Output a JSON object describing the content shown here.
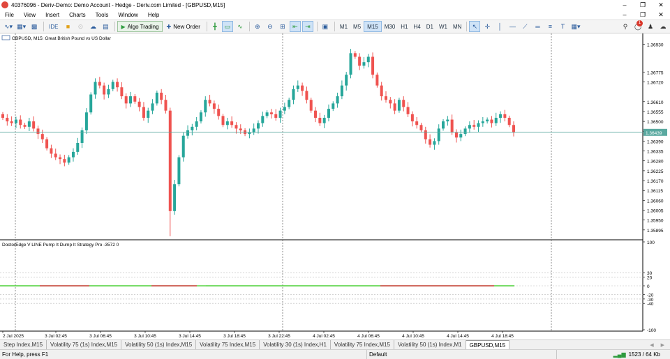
{
  "window": {
    "title": "40376096 - Deriv-Demo: Demo Account - Hedge - Deriv.com Limited - [GBPUSD,M15]",
    "minimize_icon": "minimize-icon",
    "maximize_icon": "restore-icon",
    "close_icon": "close-icon"
  },
  "menu": [
    "File",
    "View",
    "Insert",
    "Charts",
    "Tools",
    "Window",
    "Help"
  ],
  "toolbar": {
    "ide_label": "IDE",
    "algo_label": "Algo Trading",
    "neworder_label": "New Order",
    "timeframes": [
      "M1",
      "M5",
      "M15",
      "M30",
      "H1",
      "H4",
      "D1",
      "W1",
      "MN"
    ],
    "active_timeframe": "M15",
    "notification_count": "1"
  },
  "chart": {
    "symbol_caption": "GBPUSD, M15:  Great British Pound vs US Dollar",
    "indicator_caption": "DoctorEdge V LINE Pump It Dump It Strategy Pro -3572 0",
    "current_price": "1.36439",
    "price_ticks": [
      "1.36930",
      "1.36775",
      "1.36720",
      "1.36610",
      "1.36555",
      "1.36500",
      "1.36445",
      "1.36390",
      "1.36335",
      "1.36280",
      "1.36225",
      "1.36170",
      "1.36115",
      "1.36060",
      "1.36005",
      "1.35950",
      "1.35895"
    ],
    "indicator_ticks": [
      "100",
      "30",
      "20",
      "0",
      "-20",
      "-30",
      "-40",
      "-100"
    ],
    "time_ticks": [
      "2 Jul 2025",
      "3 Jul 02:45",
      "3 Jul 06:45",
      "3 Jul 10:45",
      "3 Jul 14:45",
      "3 Jul 18:45",
      "3 Jul 22:45",
      "4 Jul 02:45",
      "4 Jul 06:45",
      "4 Jul 10:45",
      "4 Jul 14:45",
      "4 Jul 18:45"
    ],
    "colors": {
      "bull": "#26a69a",
      "bear": "#ef5350",
      "price_line": "#5aa9a0",
      "ind_green": "#4cd137",
      "ind_red": "#c0392b"
    }
  },
  "chart_data": {
    "type": "candlestick",
    "symbol": "GBPUSD",
    "timeframe": "M15",
    "ylim": [
      1.3584,
      1.3699
    ],
    "close_series_approx": [
      1.3652,
      1.365,
      1.3649,
      1.3651,
      1.3648,
      1.3647,
      1.365,
      1.3646,
      1.3643,
      1.364,
      1.3635,
      1.3632,
      1.363,
      1.3629,
      1.3627,
      1.363,
      1.3633,
      1.3638,
      1.3645,
      1.3655,
      1.3665,
      1.3672,
      1.367,
      1.3665,
      1.3668,
      1.3672,
      1.3669,
      1.3664,
      1.366,
      1.3664,
      1.3661,
      1.3658,
      1.3652,
      1.3656,
      1.366,
      1.3666,
      1.3662,
      1.3656,
      1.36,
      1.3615,
      1.363,
      1.3642,
      1.3645,
      1.3647,
      1.365,
      1.3655,
      1.3662,
      1.366,
      1.3657,
      1.3653,
      1.3648,
      1.365,
      1.3648,
      1.3646,
      1.3645,
      1.3643,
      1.3644,
      1.3646,
      1.3649,
      1.3653,
      1.3655,
      1.3654,
      1.3652,
      1.3656,
      1.3658,
      1.3662,
      1.3668,
      1.367,
      1.3667,
      1.3662,
      1.3656,
      1.3652,
      1.3649,
      1.3652,
      1.3657,
      1.366,
      1.3664,
      1.367,
      1.3676,
      1.3688,
      1.3686,
      1.3681,
      1.3683,
      1.3686,
      1.3676,
      1.367,
      1.3664,
      1.3662,
      1.366,
      1.3656,
      1.3662,
      1.3658,
      1.3654,
      1.365,
      1.3648,
      1.3645,
      1.364,
      1.3637,
      1.3639,
      1.3646,
      1.365,
      1.3651,
      1.3644,
      1.3641,
      1.3643,
      1.3646,
      1.3648,
      1.3647,
      1.3649,
      1.365,
      1.3651,
      1.3649,
      1.3652,
      1.3654,
      1.3652,
      1.3648,
      1.3644
    ]
  },
  "tabs": [
    "Step Index,M15",
    "Volatility 75 (1s) Index,M15",
    "Volatility 50 (1s) Index,M15",
    "Volatility 75 Index,M15",
    "Volatility 30 (1s) Index,H1",
    "Volatility 75 Index,M15",
    "Volatility 50 (1s) Index,M1",
    "GBPUSD,M15"
  ],
  "active_tab": "GBPUSD,M15",
  "status": {
    "help": "For Help, press F1",
    "profile": "Default",
    "traffic": "1523 / 64 Kb"
  }
}
